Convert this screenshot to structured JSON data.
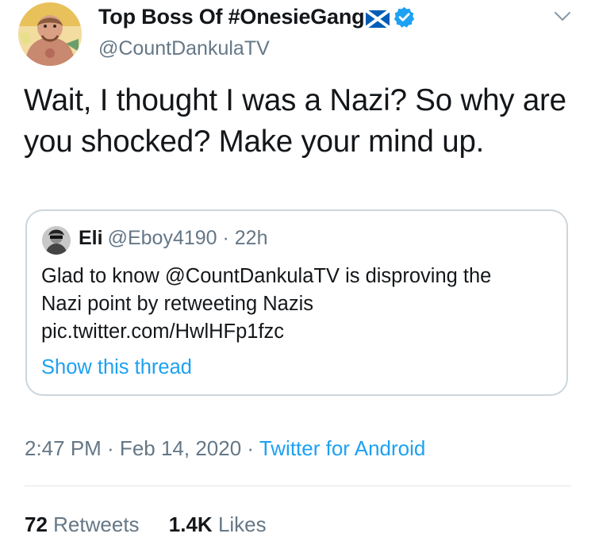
{
  "tweet": {
    "display_name": "Top Boss Of #OnesieGang",
    "flag_icon": "scotland-flag-icon",
    "verified_icon": "verified-badge-icon",
    "handle": "@CountDankulaTV",
    "caret_icon": "chevron-down-icon",
    "text": "Wait, I thought I was a Nazi? So why are you shocked? Make your mind up.",
    "timestamp": "2:47 PM · Feb 14, 2020 · ",
    "source": "Twitter for Android"
  },
  "quoted_tweet": {
    "name": "Eli",
    "handle_time": "@Eboy4190 · 22h",
    "text_line1": "Glad to know @CountDankulaTV is disproving the",
    "text_line2": "Nazi point by retweeting Nazis",
    "text_line3": "pic.twitter.com/HwlHFp1fzc",
    "show_thread": "Show this thread"
  },
  "stats": {
    "retweets_count": "72",
    "retweets_label": "Retweets",
    "likes_count": "1.4K",
    "likes_label": "Likes"
  },
  "colors": {
    "accent": "#1da1f2",
    "muted": "#657786",
    "text": "#14171a",
    "border": "#ccd6dd"
  }
}
